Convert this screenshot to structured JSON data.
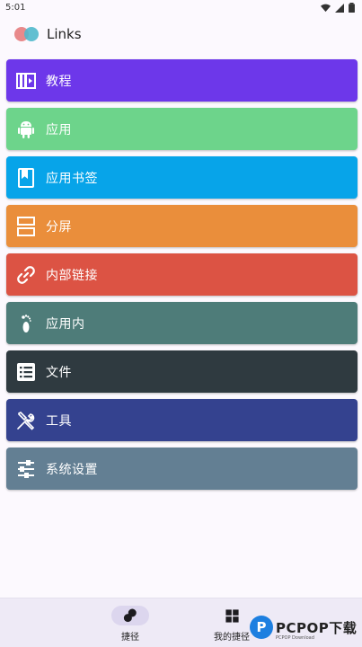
{
  "status": {
    "time": "5:01"
  },
  "app": {
    "title": "Links"
  },
  "menu": [
    {
      "label": "教程",
      "icon": "book-video-icon",
      "color": "#6d37ea"
    },
    {
      "label": "应用",
      "icon": "android-icon",
      "color": "#6dd48b"
    },
    {
      "label": "应用书签",
      "icon": "bookmark-book-icon",
      "color": "#07a4e9"
    },
    {
      "label": "分屏",
      "icon": "split-screen-icon",
      "color": "#ea8e3b"
    },
    {
      "label": "内部链接",
      "icon": "link-icon",
      "color": "#dc5344"
    },
    {
      "label": "应用内",
      "icon": "footprint-icon",
      "color": "#4e7c79"
    },
    {
      "label": "文件",
      "icon": "file-list-icon",
      "color": "#2f3a40"
    },
    {
      "label": "工具",
      "icon": "tools-icon",
      "color": "#34428f"
    },
    {
      "label": "系统设置",
      "icon": "sliders-icon",
      "color": "#637f93"
    }
  ],
  "bottom_nav": [
    {
      "label": "捷径",
      "icon": "shortcut-dots-icon",
      "active": true
    },
    {
      "label": "我的捷径",
      "icon": "grid-icon",
      "active": false
    }
  ],
  "watermark": {
    "badge": "P",
    "text": "PCPOP下载",
    "sub": "PCPOP Download"
  }
}
